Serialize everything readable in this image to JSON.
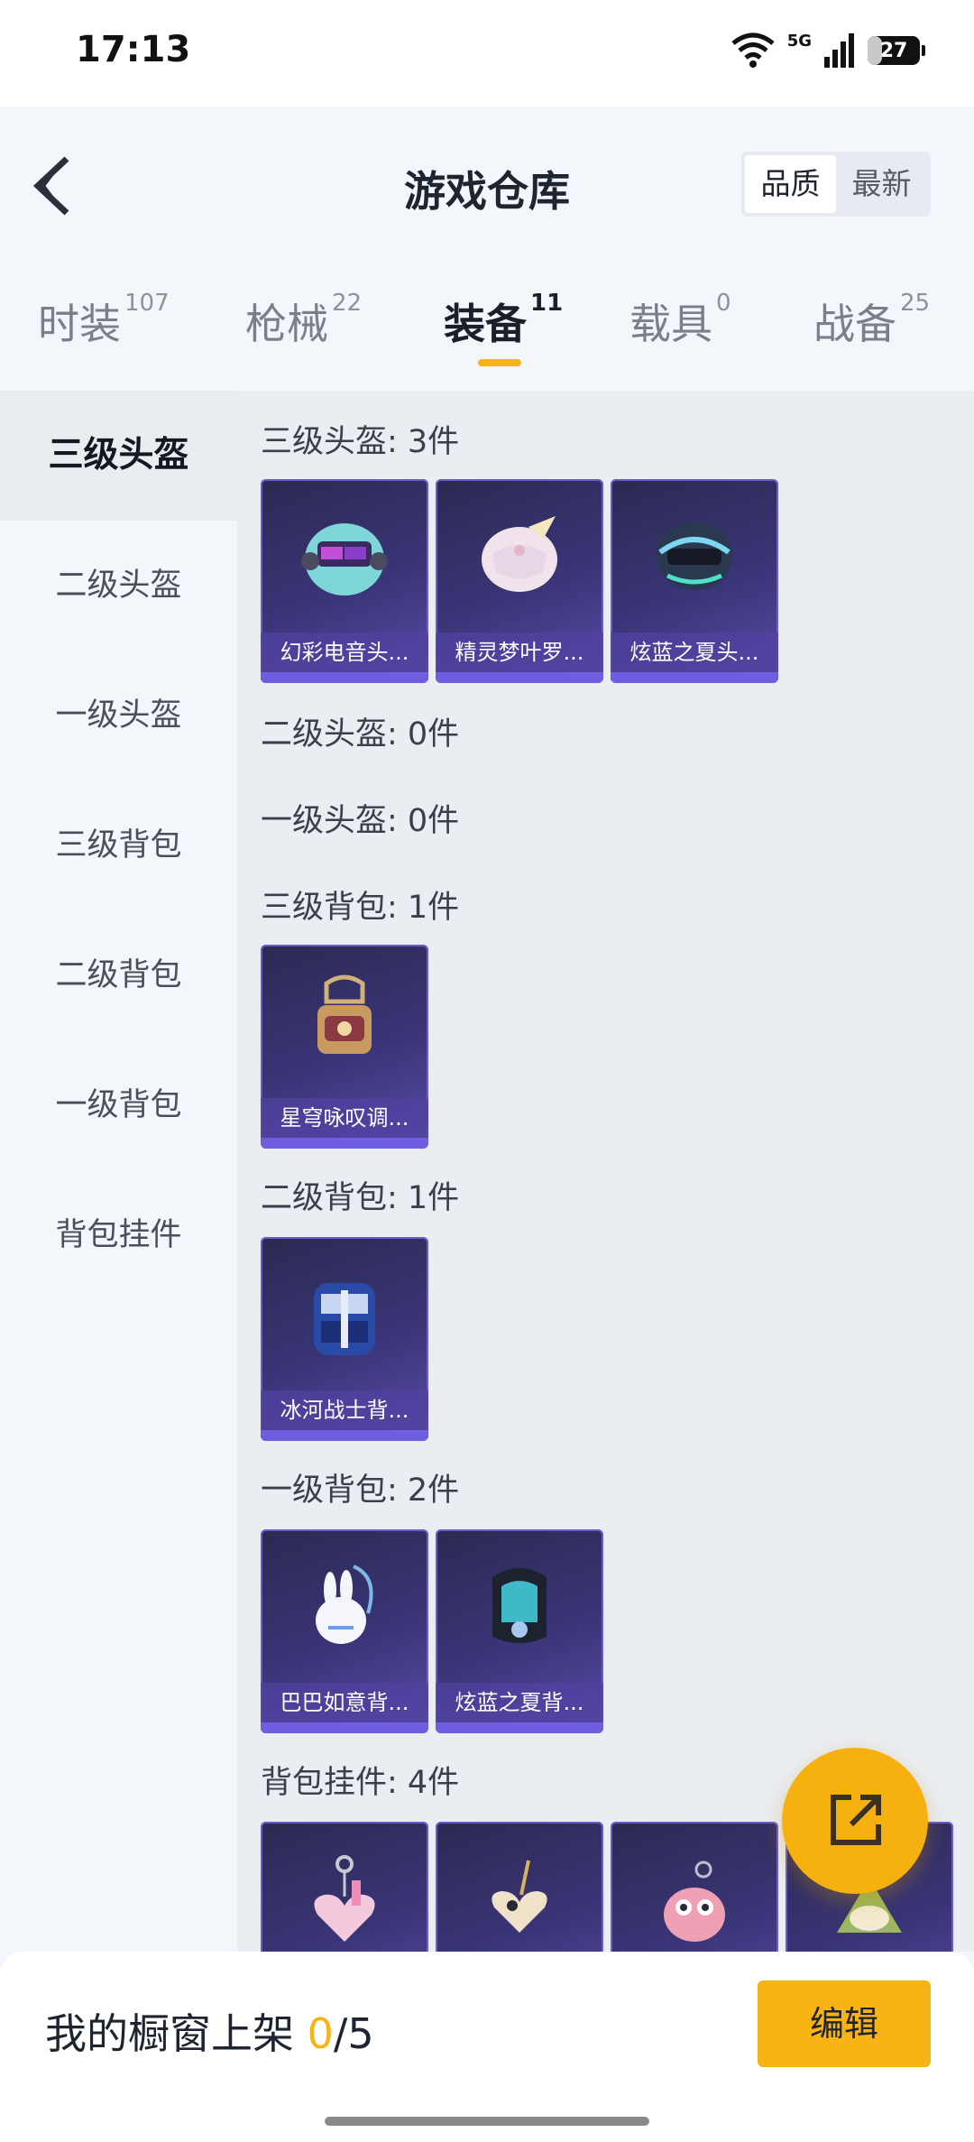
{
  "status_bar": {
    "time": "17:13",
    "network": "5G",
    "battery": "27",
    "battery_level": 0.27
  },
  "header": {
    "title": "游戏仓库",
    "sort_options": [
      "品质",
      "最新"
    ],
    "sort_selected": "品质"
  },
  "tabs": [
    {
      "label": "时装",
      "count": "107"
    },
    {
      "label": "枪械",
      "count": "22"
    },
    {
      "label": "装备",
      "count": "11",
      "active": true
    },
    {
      "label": "载具",
      "count": "0"
    },
    {
      "label": "战备",
      "count": "25"
    }
  ],
  "sidebar": {
    "items": [
      "三级头盔",
      "二级头盔",
      "一级头盔",
      "三级背包",
      "二级背包",
      "一级背包",
      "背包挂件"
    ],
    "active": "三级头盔"
  },
  "sections": [
    {
      "title": "三级头盔: 3件",
      "items": [
        "幻彩电音头...",
        "精灵梦叶罗...",
        "炫蓝之夏头..."
      ]
    },
    {
      "title": "二级头盔: 0件",
      "items": []
    },
    {
      "title": "一级头盔: 0件",
      "items": []
    },
    {
      "title": "三级背包: 1件",
      "items": [
        "星穹咏叹调..."
      ]
    },
    {
      "title": "二级背包: 1件",
      "items": [
        "冰河战士背..."
      ]
    },
    {
      "title": "一级背包: 2件",
      "items": [
        "巴巴如意背...",
        "炫蓝之夏背..."
      ]
    },
    {
      "title": "背包挂件: 4件",
      "items": [
        "",
        "",
        "",
        ""
      ]
    }
  ],
  "bottom_bar": {
    "shop_label": "我的橱窗上架",
    "shop_count": "0",
    "shop_total": "/5",
    "edit_label": "编辑"
  },
  "colors": {
    "accent": "#f6b417",
    "card_bg": "#3a3578",
    "card_border": "#6a5cc9"
  }
}
